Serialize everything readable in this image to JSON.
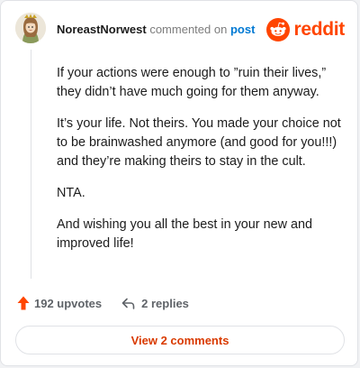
{
  "header": {
    "username": "NoreastNorwest",
    "commented_text": "commented on",
    "post_link": "post",
    "brand": "reddit"
  },
  "comment": {
    "paragraphs": [
      "If your actions were enough to ”ruin their lives,” they didn’t have much going for them anyway.",
      "It’s your life. Not theirs. You made your choice not to be brainwashed anymore (and good for you!!!) and they’re making theirs to stay in the cult.",
      "NTA.",
      "And wishing you all the best in your new and improved life!"
    ]
  },
  "actions": {
    "upvotes": "192 upvotes",
    "replies": "2 replies"
  },
  "footer": {
    "view_button": "View 2 comments"
  },
  "colors": {
    "brand_orange": "#ff4500",
    "link_blue": "#0079d3",
    "view_button_text": "#d93a00"
  },
  "icons": {
    "avatar": "user-avatar",
    "brand": "reddit-snoo-icon",
    "upvote": "upvote-arrow-icon",
    "reply": "reply-arrow-icon"
  }
}
